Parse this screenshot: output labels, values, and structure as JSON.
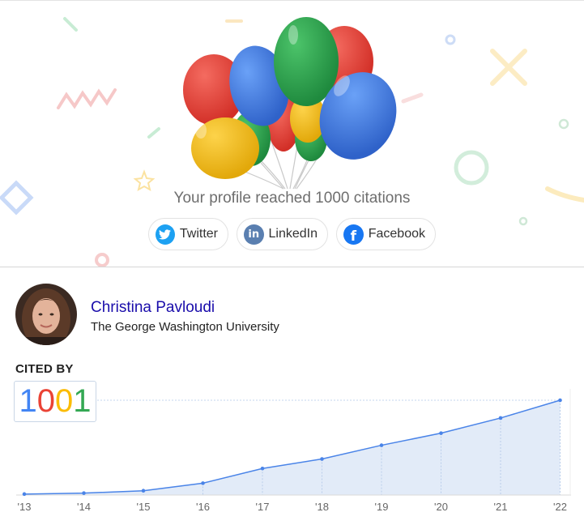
{
  "milestone": {
    "text": "Your profile reached 1000 citations"
  },
  "share": [
    {
      "label": "Twitter",
      "icon": "twitter-icon",
      "color": "#1da1f2"
    },
    {
      "label": "LinkedIn",
      "icon": "linkedin-icon",
      "color": "#5a7fb0"
    },
    {
      "label": "Facebook",
      "icon": "facebook-icon",
      "color": "#1877f2"
    }
  ],
  "profile": {
    "name": "Christina Pavloudi",
    "affiliation": "The George Washington University",
    "avatar_icon": "profile-photo"
  },
  "cited_by": {
    "label": "CITED BY",
    "count": "1001",
    "digit_colors": [
      "#4285f4",
      "#ea4335",
      "#fbbc05",
      "#34a853"
    ]
  },
  "chart_data": {
    "type": "area",
    "categories": [
      "'13",
      "'14",
      "'15",
      "'16",
      "'17",
      "'18",
      "'19",
      "'20",
      "'21",
      "'22"
    ],
    "series": [
      {
        "values": [
          4,
          8,
          18,
          50,
          112,
          152,
          210,
          261,
          325,
          400
        ]
      }
    ],
    "ylim": [
      0,
      400
    ],
    "grid": true,
    "line_color": "#4a84e8",
    "fill_color": "#e2ebf8"
  }
}
